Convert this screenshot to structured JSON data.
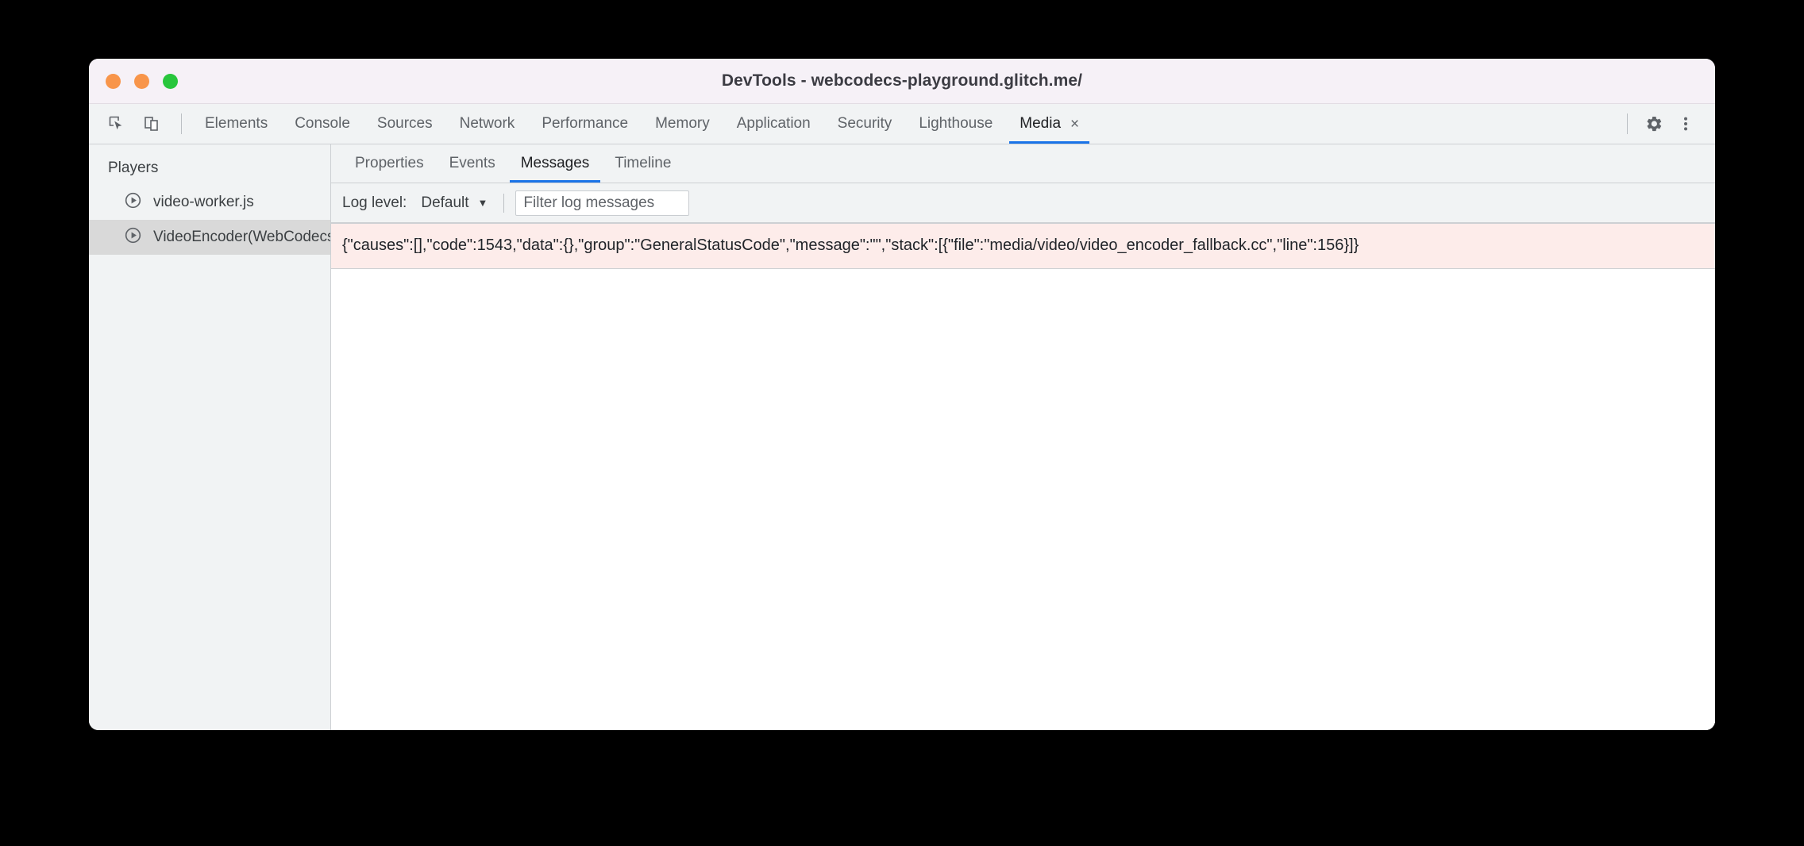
{
  "window": {
    "title": "DevTools - webcodecs-playground.glitch.me/",
    "traffic_lights": {
      "close_color": "#f8954a",
      "minimize_color": "#f8954a",
      "zoom_color": "#28c63c"
    }
  },
  "toolbar_icons": {
    "inspect": "inspect-element-icon",
    "device": "device-toolbar-icon",
    "settings": "gear-icon",
    "more": "more-vertical-icon"
  },
  "main_tabs": [
    {
      "label": "Elements",
      "active": false
    },
    {
      "label": "Console",
      "active": false
    },
    {
      "label": "Sources",
      "active": false
    },
    {
      "label": "Network",
      "active": false
    },
    {
      "label": "Performance",
      "active": false
    },
    {
      "label": "Memory",
      "active": false
    },
    {
      "label": "Application",
      "active": false
    },
    {
      "label": "Security",
      "active": false
    },
    {
      "label": "Lighthouse",
      "active": false
    },
    {
      "label": "Media",
      "active": true,
      "close": "×"
    }
  ],
  "sidebar": {
    "header": "Players",
    "items": [
      {
        "label": "video-worker.js",
        "icon": "play-circle-icon",
        "selected": false
      },
      {
        "label": "VideoEncoder(WebCodecs)",
        "icon": "play-circle-icon",
        "selected": true
      }
    ]
  },
  "panel": {
    "sub_tabs": [
      {
        "label": "Properties",
        "active": false
      },
      {
        "label": "Events",
        "active": false
      },
      {
        "label": "Messages",
        "active": true
      },
      {
        "label": "Timeline",
        "active": false
      }
    ],
    "log_toolbar": {
      "log_level_label": "Log level:",
      "log_level_value": "Default",
      "caret": "▼",
      "filter_value": "",
      "filter_placeholder": "Filter log messages"
    },
    "messages": [
      {
        "level": "error",
        "text": "{\"causes\":[],\"code\":1543,\"data\":{},\"group\":\"GeneralStatusCode\",\"message\":\"\",\"stack\":[{\"file\":\"media/video/video_encoder_fallback.cc\",\"line\":156}]}",
        "background": "#fdecea"
      }
    ]
  },
  "colors": {
    "accent": "#1a73e8",
    "chrome_bg": "#f1f3f4",
    "titlebar_bg": "#f6f1f7",
    "selected_row": "#d9d9d9",
    "error_bg": "#fdecea",
    "border": "#cdd0d3",
    "text_primary": "#202124",
    "text_secondary": "#5f6368"
  }
}
